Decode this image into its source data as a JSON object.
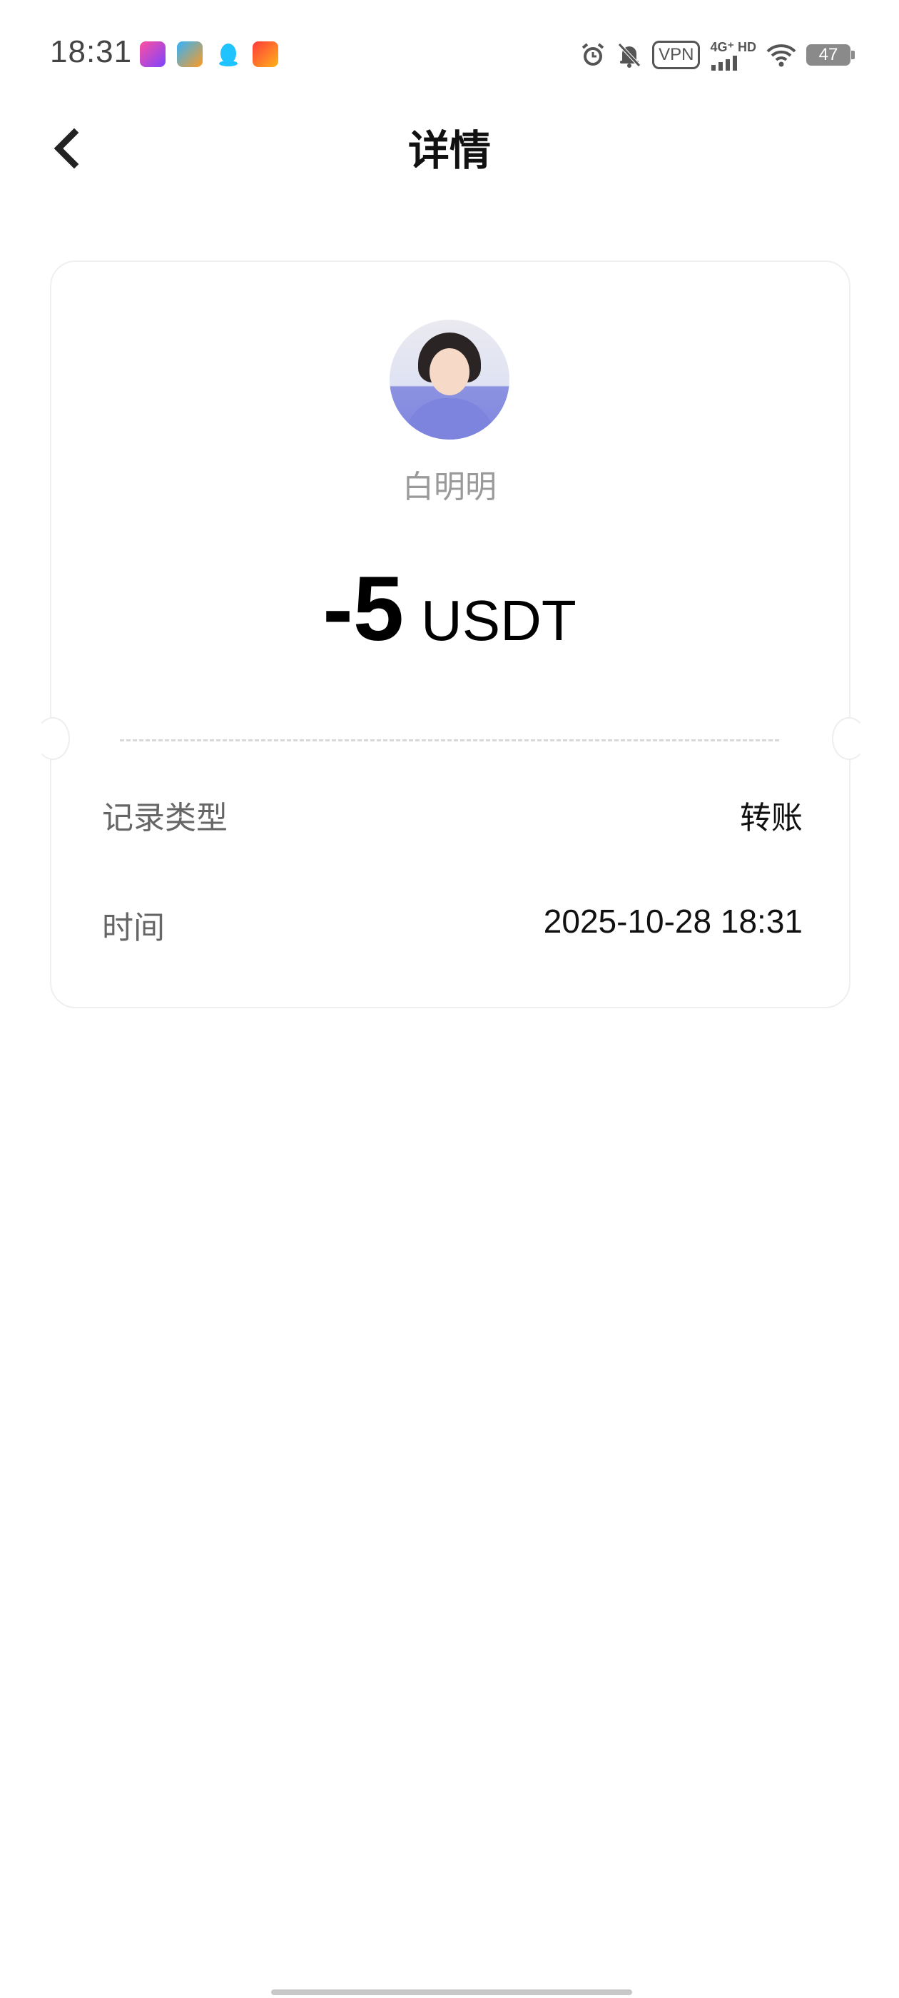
{
  "status_bar": {
    "time": "18:31",
    "app_icons": [
      "bilibili-app-icon",
      "eleme-app-icon",
      "qq-app-icon",
      "taobao-app-icon"
    ],
    "vpn_label": "VPN",
    "network_label": "4G⁺ HD",
    "battery_level": "47"
  },
  "header": {
    "title": "详情"
  },
  "card": {
    "username": "白明明",
    "amount_value": "-5",
    "amount_unit": "USDT",
    "details": [
      {
        "label": "记录类型",
        "value": "转账"
      },
      {
        "label": "时间",
        "value": "2025-10-28 18:31"
      }
    ]
  },
  "colors": {
    "background": "#ffffff",
    "title_text": "#111111",
    "secondary_text": "#9a9a9a",
    "label_text": "#666666",
    "card_border": "#efefef"
  }
}
